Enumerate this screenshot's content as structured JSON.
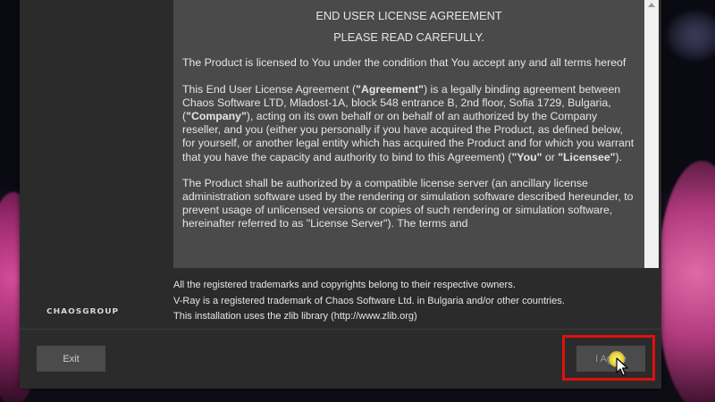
{
  "eula": {
    "title": "END USER LICENSE AGREEMENT",
    "subtitle": "PLEASE READ CAREFULLY.",
    "paragraph1": "The Product is licensed to You under the condition that You accept any and all terms hereof",
    "p2_part1": "This End User License Agreement (",
    "p2_agreement": "\"Agreement\"",
    "p2_part2": ") is a legally binding agreement between Chaos Software LTD, Mladost-1A, block 548 entrance B, 2nd floor, Sofia 1729, Bulgaria, (",
    "p2_company": "\"Company\"",
    "p2_part3": "), acting on its own behalf or on behalf of an authorized by the Company reseller, and you (either you personally if you have acquired the Product, as defined below, for yourself, or another legal entity which has acquired the Product and for which you warrant that you have the capacity and authority to bind to this Agreement) (",
    "p2_you": "\"You\"",
    "p2_or": " or ",
    "p2_licensee": "\"Licensee\"",
    "p2_end": ").",
    "paragraph3": "The Product shall be authorized by a compatible license server (an ancillary license administration software used by the rendering or simulation software described hereunder, to prevent usage of unlicensed versions or copies of such rendering or simulation software, hereinafter referred to as \"License Server\"). The terms and"
  },
  "footer": {
    "line1": "All the registered trademarks and copyrights belong to their respective owners.",
    "line2": "V-Ray is a registered trademark of Chaos Software Ltd. in Bulgaria and/or other countries.",
    "line3": "This installation uses the zlib library (http://www.zlib.org)"
  },
  "logo_text": "CHAOSGROUP",
  "buttons": {
    "exit": "Exit",
    "agree": "I Agree"
  },
  "colors": {
    "window_bg": "#2b2b2b",
    "eula_bg": "#4a4a4a",
    "highlight": "#e01010"
  }
}
